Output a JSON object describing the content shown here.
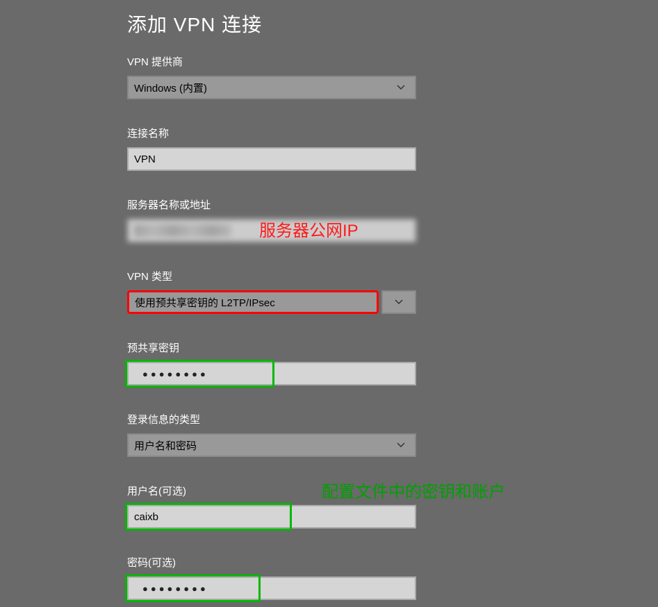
{
  "title": "添加 VPN 连接",
  "fields": {
    "provider": {
      "label": "VPN 提供商",
      "value": "Windows (内置)"
    },
    "connectionName": {
      "label": "连接名称",
      "value": "VPN"
    },
    "serverAddress": {
      "label": "服务器名称或地址",
      "value": ""
    },
    "vpnType": {
      "label": "VPN 类型",
      "value": "使用预共享密钥的 L2TP/IPsec"
    },
    "presharedKey": {
      "label": "预共享密钥",
      "value": "●●●●●●●●"
    },
    "signinInfo": {
      "label": "登录信息的类型",
      "value": "用户名和密码"
    },
    "username": {
      "label": "用户名(可选)",
      "value": "caixb"
    },
    "password": {
      "label": "密码(可选)",
      "value": "●●●●●●●●"
    }
  },
  "annotations": {
    "serverIp": "服务器公网IP",
    "configNote": "配置文件中的密钥和账户"
  }
}
